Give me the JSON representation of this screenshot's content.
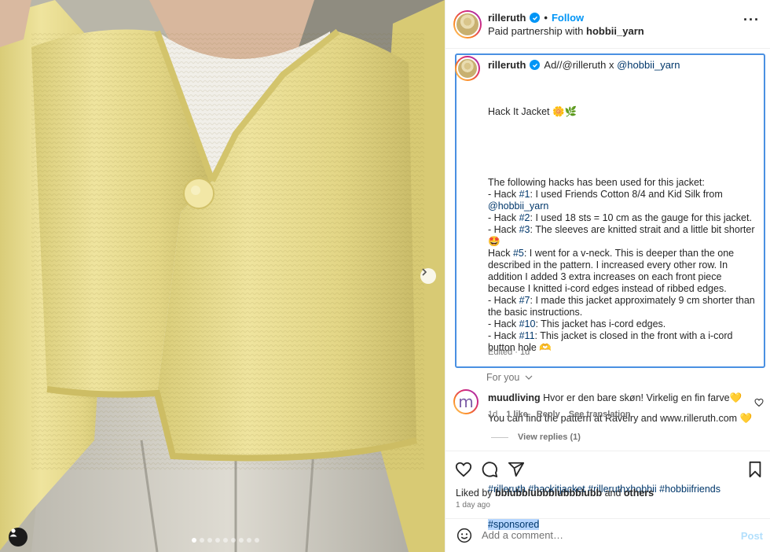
{
  "photo": {
    "alt_subject": "knitted-yellow-cardigan",
    "carousel": {
      "total": 9,
      "active_index": 0
    }
  },
  "header": {
    "username": "rilleruth",
    "separator": "•",
    "follow_label": "Follow",
    "subtitle_prefix": "Paid partnership with ",
    "partner": "hobbii_yarn"
  },
  "caption": {
    "username": "rilleruth",
    "intro_prefix": "Ad//@rilleruth x ",
    "intro_mention": "@hobbii_yarn",
    "title": "Hack It Jacket 🌼🌿",
    "body_lines": [
      "The following hacks has been used for this jacket:",
      "- Hack #1: I used Friends Cotton 8/4 and Kid Silk from",
      "@hobbii_yarn",
      "- Hack #2: I used 18 sts = 10 cm as the gauge for this jacket.",
      "- Hack #3: The sleeves are knitted strait and a little bit shorter",
      "🤩",
      "Hack #5: I went for a v-neck. This is deeper than the one",
      "described in the pattern. I increased every other row. In",
      "addition I added 3 extra increases on each front piece",
      "because I knitted i-cord edges instead of ribbed edges.",
      "- Hack #7: I made this jacket approximately 9 cm shorter than",
      "the basic instructions.",
      "- Hack #10: This jacket has i-cord edges.",
      "- Hack #11: This jacket is closed in the front with a i-cord",
      "button hole 🫶"
    ],
    "pattern_line": "You can find the pattern at Ravelry and www.rilleruth.com 💛",
    "hashtags": "#rilleruth #hackitjacket #rilleruthxhobbii #hobbiifriends",
    "hashtag_selected": "#sponsored",
    "edited": "Edited · 1d"
  },
  "for_you_label": "For you",
  "comment": {
    "avatar_letter": "m",
    "username": "muudliving",
    "text": "Hvor er den bare skøn! Virkelig en fin farve💛",
    "time": "1d",
    "likes": "1 like",
    "reply_label": "Reply",
    "translate_label": "See translation",
    "view_replies": "View replies (1)"
  },
  "likes": {
    "prefix": "Liked by ",
    "user": "bblubblubbblubbblubb",
    "middle": " and ",
    "others": "others",
    "time_ago": "1 day ago"
  },
  "add_comment": {
    "placeholder": "Add a comment…",
    "post_label": "Post"
  },
  "colors": {
    "accent": "#0095f6",
    "selection_border": "#4a90e2",
    "post_disabled": "#b2dffc",
    "cardigan": "#e6d98a"
  }
}
